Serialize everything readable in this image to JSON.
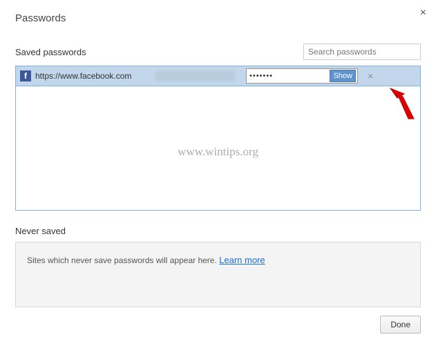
{
  "title": "Passwords",
  "close_glyph": "×",
  "saved": {
    "label": "Saved passwords",
    "search_placeholder": "Search passwords",
    "rows": [
      {
        "icon": "facebook-icon",
        "icon_letter": "f",
        "site": "https://www.facebook.com",
        "password_mask": "•••••••",
        "show_label": "Show",
        "remove_glyph": "×"
      }
    ]
  },
  "watermark": "www.wintips.org",
  "never": {
    "label": "Never saved",
    "text": "Sites which never save passwords will appear here. ",
    "learn_more": "Learn more"
  },
  "done_label": "Done",
  "colors": {
    "row_selected": "#c2d7ec",
    "border_selected": "#7bb2e8",
    "fb_blue": "#3b5998",
    "show_btn": "#5d94cf",
    "arrow": "#e30000"
  }
}
